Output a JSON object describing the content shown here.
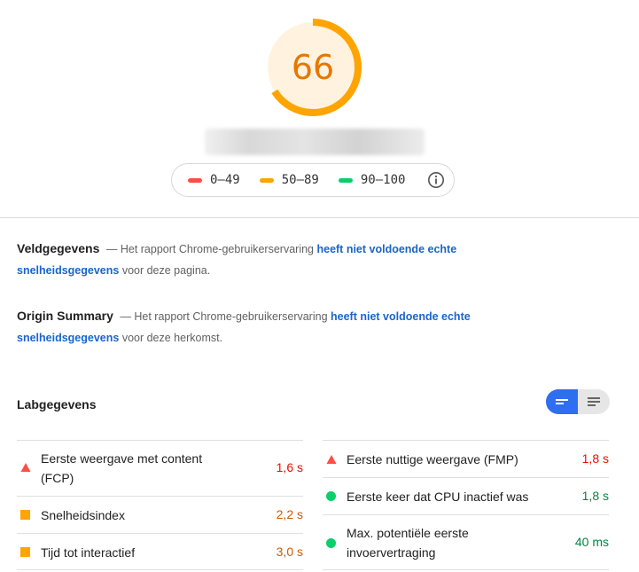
{
  "score": {
    "value": "66",
    "fraction": 0.66,
    "color": "#ffa400",
    "text_color": "#e67700",
    "fill": "#fff3e0"
  },
  "legend": [
    {
      "range": "0–49",
      "color": "#ff4e42"
    },
    {
      "range": "50–89",
      "color": "#ffa400"
    },
    {
      "range": "90–100",
      "color": "#0cce6b"
    }
  ],
  "field_data": {
    "title": "Veldgegevens",
    "prefix": "— Het rapport Chrome-gebruikerservaring",
    "link": "heeft niet voldoende echte snelheidsgegevens",
    "suffix": "voor deze pagina."
  },
  "origin_summary": {
    "title": "Origin Summary",
    "prefix": "— Het rapport Chrome-gebruikerservaring",
    "link": "heeft niet voldoende echte snelheidsgegevens",
    "suffix": "voor deze herkomst."
  },
  "lab_data": {
    "title": "Labgegevens",
    "left": [
      {
        "label_1": "Eerste weergave met content",
        "label_2": "(FCP)",
        "value": "1,6 s",
        "status": "fail"
      },
      {
        "label_1": "Snelheidsindex",
        "label_2": "",
        "value": "2,2 s",
        "status": "average"
      },
      {
        "label_1": "Tijd tot interactief",
        "label_2": "",
        "value": "3,0 s",
        "status": "average"
      }
    ],
    "right": [
      {
        "label_1": "Eerste nuttige weergave (FMP)",
        "label_2": "",
        "value": "1,8 s",
        "status": "fail"
      },
      {
        "label_1": "Eerste keer dat CPU inactief was",
        "label_2": "",
        "value": "1,8 s",
        "status": "pass"
      },
      {
        "label_1": "Max. potentiële eerste",
        "label_2": "invoervertraging",
        "value": "40 ms",
        "status": "pass"
      }
    ]
  },
  "status_colors": {
    "fail": "#eb0f00",
    "average": "#d25a00",
    "pass": "#018642"
  },
  "marker_colors": {
    "fail": "#ff4e42",
    "average": "#ffa400",
    "pass": "#0cce6b"
  },
  "icons": {
    "legend_info": "info-icon",
    "toggle_on": "expanded-view-icon",
    "toggle_off": "compact-view-icon"
  }
}
